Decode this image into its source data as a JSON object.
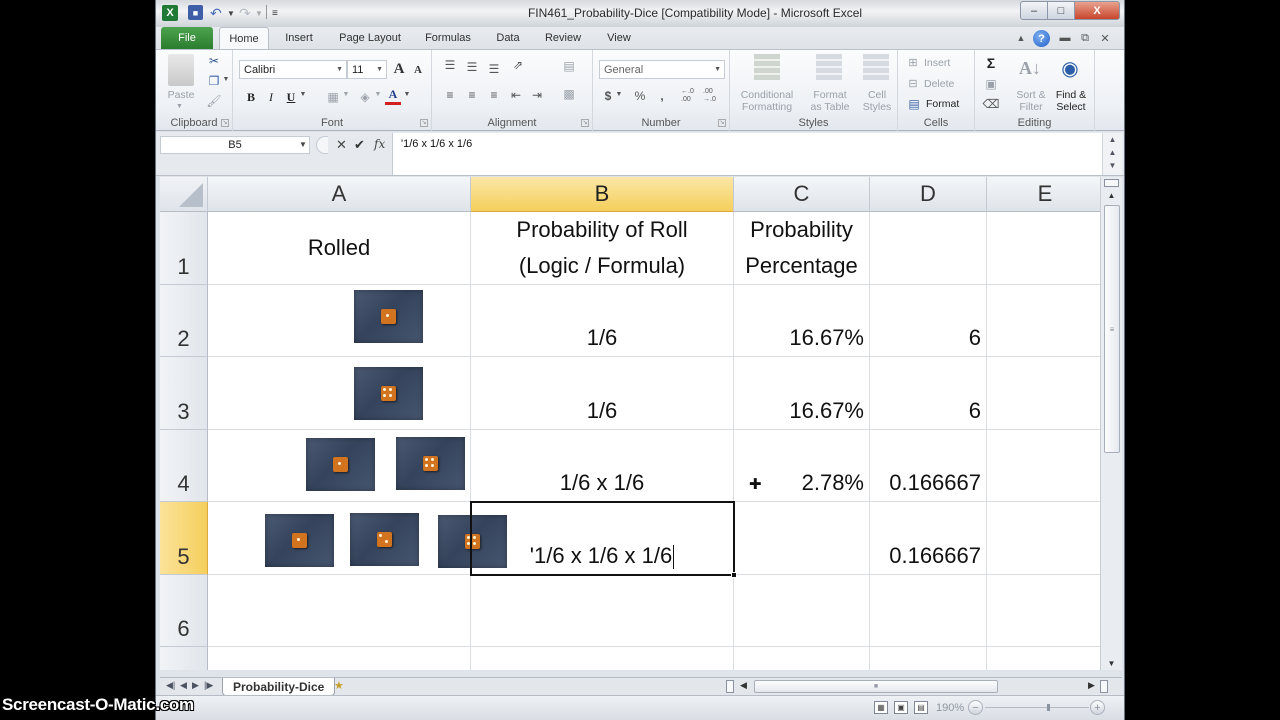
{
  "window": {
    "title": "FIN461_Probability-Dice  [Compatibility Mode] - Microsoft Excel",
    "app_icon": "X",
    "minimize_label": "–",
    "maximize_label": "□",
    "close_label": "X"
  },
  "quick_access": {
    "save_icon": "save-icon",
    "undo_icon": "undo-icon",
    "redo_icon": "redo-icon",
    "customize_icon": "customize-qat-icon"
  },
  "tabs": [
    {
      "label": "File"
    },
    {
      "label": "Home",
      "active": true
    },
    {
      "label": "Insert"
    },
    {
      "label": "Page Layout"
    },
    {
      "label": "Formulas"
    },
    {
      "label": "Data"
    },
    {
      "label": "Review"
    },
    {
      "label": "View"
    }
  ],
  "ribbon": {
    "clipboard": {
      "label": "Clipboard",
      "paste": "Paste"
    },
    "font": {
      "label": "Font",
      "font_name": "Calibri",
      "font_size": "11",
      "bold": "B",
      "italic": "I",
      "underline": "U",
      "grow": "A",
      "shrink": "A",
      "font_color": "A"
    },
    "alignment": {
      "label": "Alignment"
    },
    "number": {
      "label": "Number",
      "format": "General",
      "currency": "$",
      "percent": "%",
      "comma": ",",
      "inc_decimal": "←.0 .00",
      "dec_decimal": ".00 →.0"
    },
    "styles": {
      "label": "Styles",
      "conditional": [
        "Conditional",
        "Formatting"
      ],
      "format_table": [
        "Format",
        "as Table"
      ],
      "cell_styles": [
        "Cell",
        "Styles"
      ]
    },
    "cells": {
      "label": "Cells",
      "insert": "Insert",
      "delete": "Delete",
      "format": "Format"
    },
    "editing": {
      "label": "Editing",
      "sum": "Σ",
      "sort_filter": [
        "Sort &",
        "Filter"
      ],
      "find_select": [
        "Find &",
        "Select"
      ]
    }
  },
  "formula_bar": {
    "name_box": "B5",
    "cancel": "✕",
    "enter": "✔",
    "fx": "fx",
    "content": "'1/6 x 1/6 x 1/6"
  },
  "sheet": {
    "columns": [
      "A",
      "B",
      "C",
      "D",
      "E"
    ],
    "selected_column": "B",
    "selected_row": "5",
    "rows": [
      {
        "num": "1",
        "A": "Rolled",
        "B": [
          "Probability of Roll",
          "(Logic / Formula)"
        ],
        "C": [
          "Probability",
          "Percentage"
        ],
        "D": "",
        "E": ""
      },
      {
        "num": "2",
        "A_dice": [
          [
            1
          ]
        ],
        "B": "1/6",
        "C": "16.67%",
        "D": "6",
        "E": ""
      },
      {
        "num": "3",
        "A_dice": [
          [
            4
          ]
        ],
        "B": "1/6",
        "C": "16.67%",
        "D": "6",
        "E": ""
      },
      {
        "num": "4",
        "A_dice": [
          [
            1
          ],
          [
            4
          ]
        ],
        "B": "1/6 x 1/6",
        "C": "2.78%",
        "D": "0.166667",
        "E": ""
      },
      {
        "num": "5",
        "A_dice": [
          [
            1
          ],
          [
            2
          ],
          [
            4
          ]
        ],
        "B": "'1/6 x 1/6 x 1/6",
        "C": "",
        "D": "0.166667",
        "E": ""
      },
      {
        "num": "6",
        "B": "",
        "C": "",
        "D": "",
        "E": ""
      }
    ]
  },
  "sheet_tabs": [
    {
      "label": "Probability-Dice",
      "active": true
    }
  ],
  "status": {
    "zoom": "190%",
    "zoom_fraction": 0.6
  },
  "watermark": "Screencast-O-Matic.com"
}
